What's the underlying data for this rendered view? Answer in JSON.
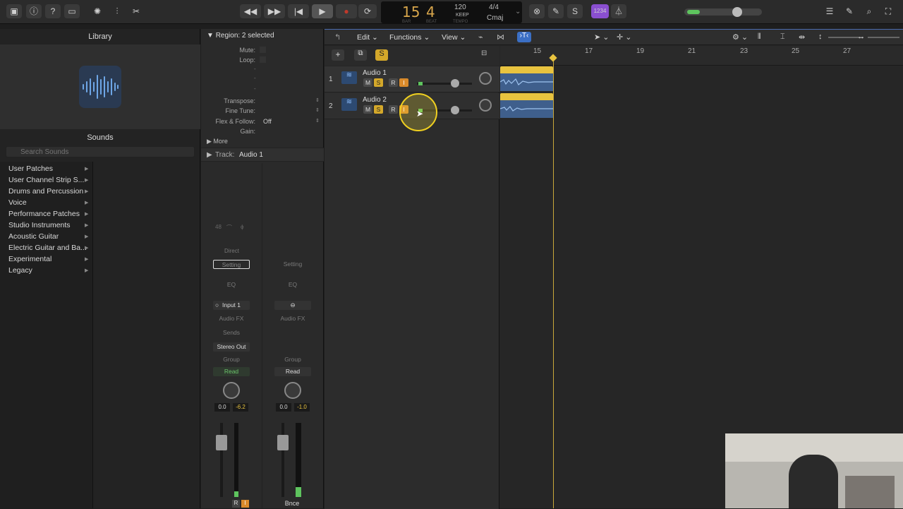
{
  "toolbar": {
    "lcd": {
      "bar": "15",
      "beat": "4",
      "bar_label": "BAR",
      "beat_label": "BEAT",
      "tempo": "120",
      "tempo_mode": "KEEP",
      "tempo_label": "TEMPO",
      "signature": "4/4",
      "key": "Cmaj"
    },
    "chord_tool": "1234"
  },
  "library": {
    "title": "Library",
    "sounds_title": "Sounds",
    "search_placeholder": "Search Sounds",
    "items": [
      "User Patches",
      "User Channel Strip S...",
      "Drums and Percussion",
      "Voice",
      "Performance Patches",
      "Studio Instruments",
      "Acoustic Guitar",
      "Electric Guitar and Ba...",
      "Experimental",
      "Legacy"
    ]
  },
  "inspector": {
    "region_header": "Region: 2 selected",
    "mute_label": "Mute:",
    "loop_label": "Loop:",
    "dash": "-",
    "transpose_label": "Transpose:",
    "finetune_label": "Fine Tune:",
    "flex_label": "Flex & Follow:",
    "flex_value": "Off",
    "gain_label": "Gain:",
    "more_label": "More",
    "track_label": "Track:",
    "track_value": "Audio 1",
    "strip1": {
      "sample_rate": "48",
      "direct": "Direct",
      "setting": "Setting",
      "eq": "EQ",
      "input": "Input 1",
      "audio_fx": "Audio FX",
      "sends": "Sends",
      "output": "Stereo Out",
      "group": "Group",
      "automation": "Read",
      "vol": "0.0",
      "peak": "-6.2",
      "r_btn": "R",
      "i_btn": "I"
    },
    "strip2": {
      "setting": "Setting",
      "eq": "EQ",
      "audio_fx": "Audio FX",
      "group": "Group",
      "automation": "Read",
      "vol": "0.0",
      "peak": "-1.0",
      "name": "Bnce"
    }
  },
  "tracks_area": {
    "menu": {
      "edit": "Edit",
      "functions": "Functions",
      "view": "View"
    },
    "global_solo": "S",
    "ruler": [
      "15",
      "17",
      "19",
      "21",
      "23",
      "25",
      "27"
    ],
    "tracks": [
      {
        "number": "1",
        "name": "Audio 1",
        "m": "M",
        "s": "S",
        "r": "R",
        "i": "I"
      },
      {
        "number": "2",
        "name": "Audio 2",
        "m": "M",
        "s": "S",
        "r": "R",
        "i": "I"
      }
    ]
  },
  "colors": {
    "accent_yellow": "#e8c33f",
    "region_blue": "#3f5f8c",
    "lcd_amber": "#d8a64b",
    "record_red": "#c0392b",
    "selection_blue": "#4a6bb0"
  }
}
